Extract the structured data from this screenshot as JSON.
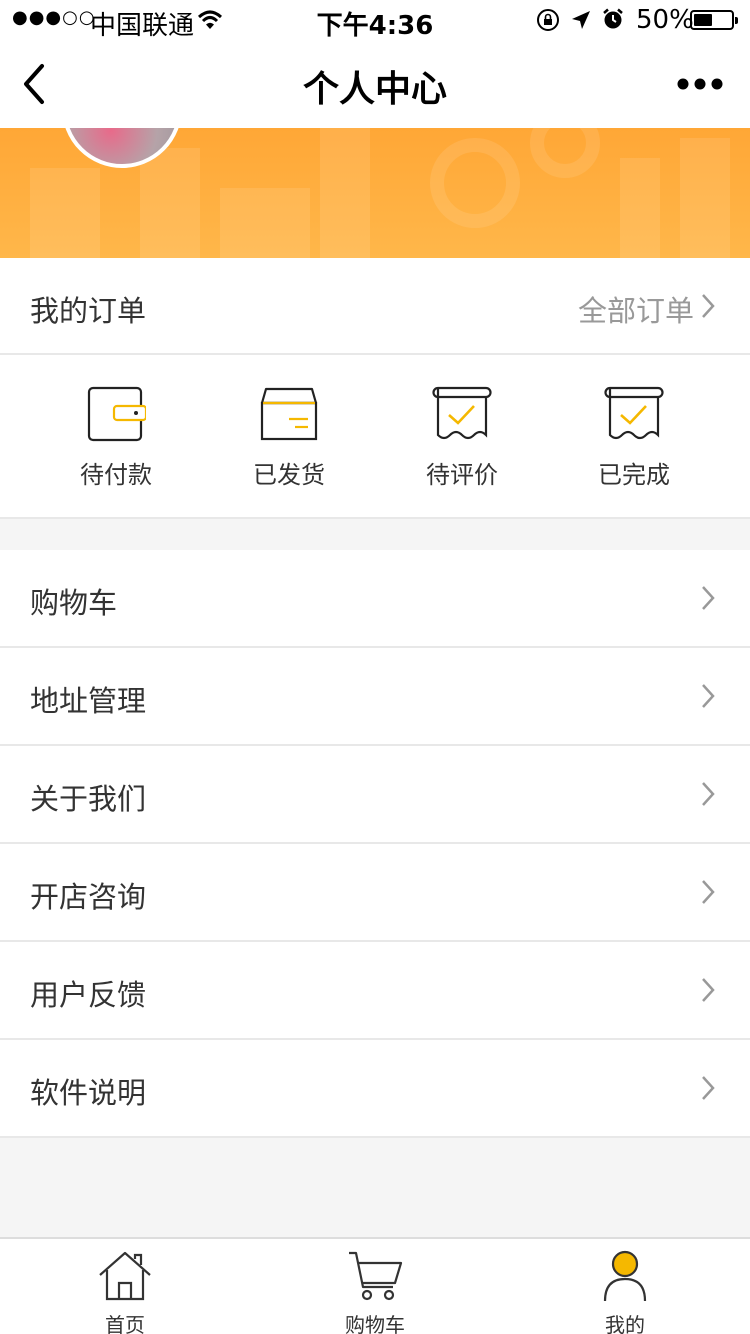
{
  "status_bar": {
    "signal": "●●●○○",
    "carrier": "中国联通",
    "time": "下午4:36",
    "battery_percent": "50%",
    "battery_level": 0.5
  },
  "nav": {
    "title": "个人中心",
    "back_icon": "chevron-left-icon",
    "more_icon": "more-dots-icon"
  },
  "colors": {
    "accent": "#ffa736",
    "icon_accent": "#f5b800",
    "text": "#333333",
    "muted": "#999999"
  },
  "orders": {
    "title": "我的订单",
    "all_label": "全部订单",
    "statuses": [
      {
        "label": "待付款",
        "icon": "wallet-icon"
      },
      {
        "label": "已发货",
        "icon": "box-icon"
      },
      {
        "label": "待评价",
        "icon": "receipt-check-icon"
      },
      {
        "label": "已完成",
        "icon": "receipt-done-icon"
      }
    ]
  },
  "menu": [
    {
      "label": "购物车"
    },
    {
      "label": "地址管理"
    },
    {
      "label": "关于我们"
    },
    {
      "label": "开店咨询"
    },
    {
      "label": "用户反馈"
    },
    {
      "label": "软件说明"
    }
  ],
  "tabs": [
    {
      "label": "首页",
      "icon": "home-icon",
      "active": false
    },
    {
      "label": "购物车",
      "icon": "cart-icon",
      "active": false
    },
    {
      "label": "我的",
      "icon": "user-icon",
      "active": true
    }
  ]
}
